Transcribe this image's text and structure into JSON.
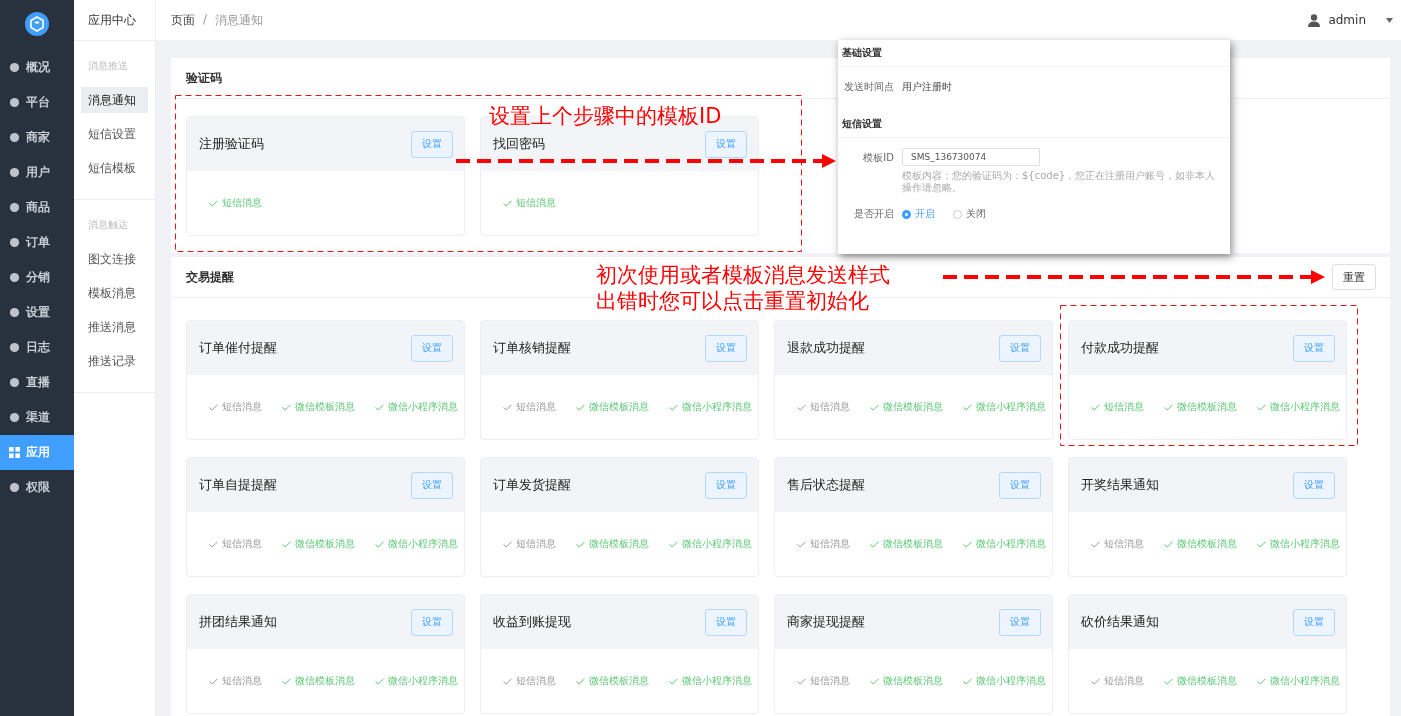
{
  "sidebar": {
    "items": [
      {
        "label": "概况",
        "selected": false
      },
      {
        "label": "平台",
        "selected": false
      },
      {
        "label": "商家",
        "selected": false
      },
      {
        "label": "用户",
        "selected": false
      },
      {
        "label": "商品",
        "selected": false
      },
      {
        "label": "订单",
        "selected": false
      },
      {
        "label": "分销",
        "selected": false
      },
      {
        "label": "设置",
        "selected": false
      },
      {
        "label": "日志",
        "selected": false
      },
      {
        "label": "直播",
        "selected": false
      },
      {
        "label": "渠道",
        "selected": false
      },
      {
        "label": "应用",
        "selected": true
      },
      {
        "label": "权限",
        "selected": false
      }
    ]
  },
  "submenu": {
    "title": "应用中心",
    "groups": [
      {
        "heading": "消息推送",
        "items": [
          {
            "label": "消息通知",
            "selected": true
          },
          {
            "label": "短信设置",
            "selected": false
          },
          {
            "label": "短信模板",
            "selected": false
          }
        ]
      },
      {
        "heading": "消息触达",
        "items": [
          {
            "label": "图文连接",
            "selected": false
          },
          {
            "label": "模板消息",
            "selected": false
          },
          {
            "label": "推送消息",
            "selected": false
          },
          {
            "label": "推送记录",
            "selected": false
          }
        ]
      }
    ]
  },
  "breadcrumb": {
    "items": [
      "页面",
      "消息通知"
    ],
    "separator": "/"
  },
  "user": {
    "name": "admin"
  },
  "sections": [
    {
      "title": "验证码",
      "cards": [
        {
          "title": "注册验证码",
          "button": "设置",
          "channels": [
            {
              "label": "短信消息",
              "on": true
            }
          ]
        },
        {
          "title": "找回密码",
          "button": "设置",
          "channels": [
            {
              "label": "短信消息",
              "on": true
            }
          ]
        }
      ]
    },
    {
      "title": "交易提醒",
      "action": "重置",
      "cards": [
        {
          "title": "订单催付提醒",
          "button": "设置",
          "channels": [
            {
              "label": "短信消息",
              "on": false
            },
            {
              "label": "微信模板消息",
              "on": true
            },
            {
              "label": "微信小程序消息",
              "on": true
            }
          ]
        },
        {
          "title": "订单核销提醒",
          "button": "设置",
          "channels": [
            {
              "label": "短信消息",
              "on": false
            },
            {
              "label": "微信模板消息",
              "on": true
            },
            {
              "label": "微信小程序消息",
              "on": true
            }
          ]
        },
        {
          "title": "退款成功提醒",
          "button": "设置",
          "channels": [
            {
              "label": "短信消息",
              "on": false
            },
            {
              "label": "微信模板消息",
              "on": true
            },
            {
              "label": "微信小程序消息",
              "on": true
            }
          ]
        },
        {
          "title": "付款成功提醒",
          "button": "设置",
          "channels": [
            {
              "label": "短信消息",
              "on": true
            },
            {
              "label": "微信模板消息",
              "on": true
            },
            {
              "label": "微信小程序消息",
              "on": true
            }
          ]
        },
        {
          "title": "订单自提提醒",
          "button": "设置",
          "channels": [
            {
              "label": "短信消息",
              "on": false
            },
            {
              "label": "微信模板消息",
              "on": true
            },
            {
              "label": "微信小程序消息",
              "on": true
            }
          ]
        },
        {
          "title": "订单发货提醒",
          "button": "设置",
          "channels": [
            {
              "label": "短信消息",
              "on": false
            },
            {
              "label": "微信模板消息",
              "on": true
            },
            {
              "label": "微信小程序消息",
              "on": true
            }
          ]
        },
        {
          "title": "售后状态提醒",
          "button": "设置",
          "channels": [
            {
              "label": "短信消息",
              "on": false
            },
            {
              "label": "微信模板消息",
              "on": true
            },
            {
              "label": "微信小程序消息",
              "on": true
            }
          ]
        },
        {
          "title": "开奖结果通知",
          "button": "设置",
          "channels": [
            {
              "label": "短信消息",
              "on": false
            },
            {
              "label": "微信模板消息",
              "on": true
            },
            {
              "label": "微信小程序消息",
              "on": true
            }
          ]
        },
        {
          "title": "拼团结果通知",
          "button": "设置",
          "channels": [
            {
              "label": "短信消息",
              "on": false
            },
            {
              "label": "微信模板消息",
              "on": true
            },
            {
              "label": "微信小程序消息",
              "on": true
            }
          ]
        },
        {
          "title": "收益到账提现",
          "button": "设置",
          "channels": [
            {
              "label": "短信消息",
              "on": false
            },
            {
              "label": "微信模板消息",
              "on": true
            },
            {
              "label": "微信小程序消息",
              "on": true
            }
          ]
        },
        {
          "title": "商家提现提醒",
          "button": "设置",
          "channels": [
            {
              "label": "短信消息",
              "on": false
            },
            {
              "label": "微信模板消息",
              "on": true
            },
            {
              "label": "微信小程序消息",
              "on": true
            }
          ]
        },
        {
          "title": "砍价结果通知",
          "button": "设置",
          "channels": [
            {
              "label": "短信消息",
              "on": false
            },
            {
              "label": "微信模板消息",
              "on": true
            },
            {
              "label": "微信小程序消息",
              "on": true
            }
          ]
        }
      ]
    }
  ],
  "popup": {
    "sections": [
      {
        "heading": "基础设置",
        "fields": [
          {
            "kind": "text",
            "label": "发送时间点",
            "value": "用户注册时"
          }
        ]
      },
      {
        "heading": "短信设置",
        "fields": [
          {
            "kind": "input",
            "label": "模板ID",
            "value": "SMS_136730074",
            "hint": "模板内容：您的验证码为：${code}，您正在注册用户账号，如非本人操作请忽略。"
          },
          {
            "kind": "radio",
            "label": "是否开启",
            "options": [
              {
                "label": "开启",
                "selected": true
              },
              {
                "label": "关闭",
                "selected": false
              }
            ]
          }
        ]
      }
    ]
  },
  "annotations": [
    {
      "lines": [
        "设置上个步骤中的模板ID"
      ]
    },
    {
      "lines": [
        "初次使用或者模板消息发送样式",
        "出错时您可以点击重置初始化"
      ]
    }
  ]
}
